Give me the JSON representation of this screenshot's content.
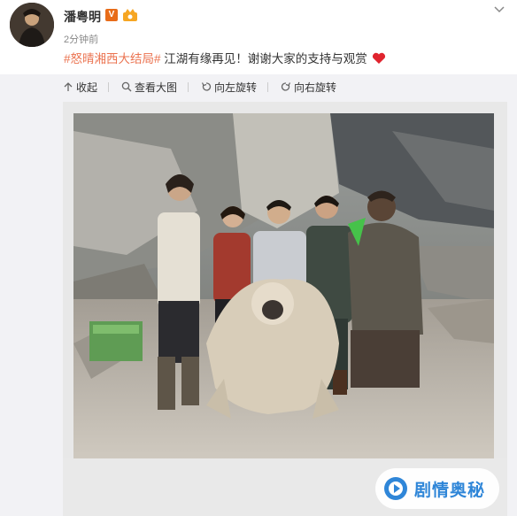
{
  "post": {
    "username": "潘粤明",
    "vip_badge": "V",
    "timestamp": "2分钟前",
    "hashtag": "#怒晴湘西大结局#",
    "body_text": "江湖有缘再见！谢谢大家的支持与观赏"
  },
  "toolbar": {
    "collapse_label": "收起",
    "view_large_label": "查看大图",
    "rotate_left_label": "向左旋转",
    "rotate_right_label": "向右旋转"
  },
  "watermark": {
    "text": "剧情奥秘"
  },
  "colors": {
    "hashtag": "#eb7350",
    "heart": "#e0242e",
    "watermark": "#2f86d8",
    "vip_badge": "#e86c19"
  },
  "icons": [
    "menu-chevron-icon",
    "collapse-arrow-icon",
    "magnifier-icon",
    "rotate-left-icon",
    "rotate-right-icon",
    "heart-icon",
    "vip-icon",
    "member-crown-icon"
  ]
}
